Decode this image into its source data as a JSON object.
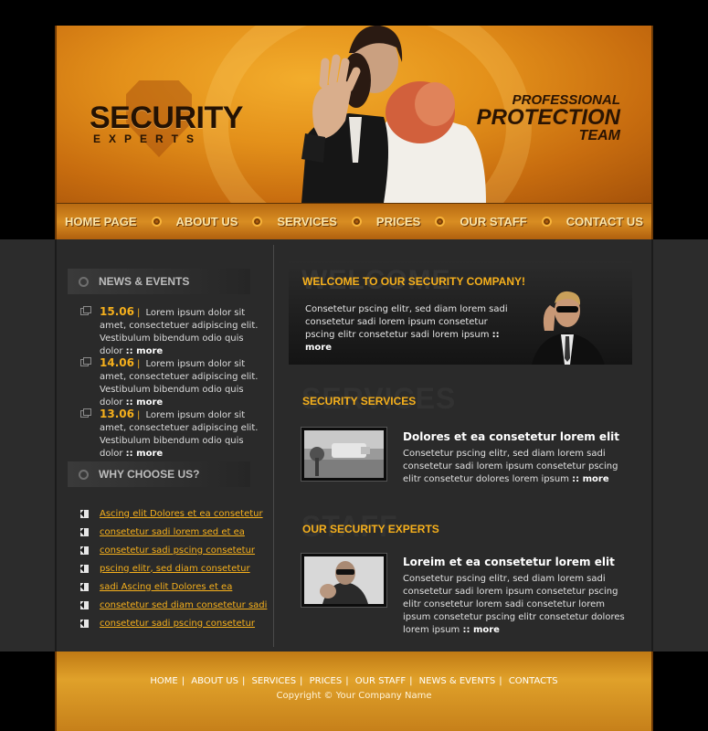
{
  "header": {
    "logo_title": "SECURITY",
    "logo_sub": "EXPERTS",
    "tagline_1": "PROFESSIONAL",
    "tagline_2": "PROTECTION",
    "tagline_3": "TEAM"
  },
  "nav": {
    "items": [
      "HOME PAGE",
      "ABOUT US",
      "SERVICES",
      "PRICES",
      "OUR STAFF",
      "CONTACT US"
    ]
  },
  "sidebar": {
    "news_title": "NEWS & EVENTS",
    "news": [
      {
        "date": "15.06",
        "text": "Lorem ipsum dolor sit amet, consectetuer adipiscing elit. Vestibulum bibendum odio quis dolor",
        "more": "more"
      },
      {
        "date": "14.06",
        "text": "Lorem ipsum dolor sit amet, consectetuer adipiscing elit. Vestibulum bibendum odio quis dolor",
        "more": "more"
      },
      {
        "date": "13.06",
        "text": "Lorem ipsum dolor sit amet, consectetuer adipiscing elit. Vestibulum bibendum odio quis dolor",
        "more": "more"
      }
    ],
    "why_title": "WHY CHOOSE US?",
    "links": [
      "Ascing elit Dolores et ea consetetur",
      "consetetur sadi lorem sed  et ea",
      "consetetur sadi pscing consetetur",
      "pscing elitr, sed diam consetetur",
      "sadi Ascing elit Dolores et ea",
      "consetetur sed diam consetetur sadi",
      "consetetur sadi pscing consetetur "
    ]
  },
  "welcome": {
    "ghost": "WELCOME",
    "title": "WELCOME TO OUR SECURITY COMPANY!",
    "text": "Consetetur pscing elitr, sed diam lorem sadi consetetur sadi lorem ipsum consetetur pscing elitr consetetur sadi lorem ipsum",
    "more": "more"
  },
  "services": {
    "ghost": "SERVICES",
    "title": "SECURITY SERVICES",
    "article_title": "Dolores et ea consetetur lorem elit",
    "article_text": "Consetetur pscing elitr, sed diam lorem sadi consetetur sadi lorem ipsum consetetur pscing elitr consetetur dolores lorem ipsum",
    "more": "more"
  },
  "experts": {
    "ghost": "STAFF",
    "title": "OUR SECURITY EXPERTS",
    "article_title": "Loreim et ea consetetur lorem elit",
    "article_text": "Consetetur pscing elitr, sed diam lorem sadi consetetur sadi lorem ipsum consetetur pscing elitr consetetur lorem sadi consetetur lorem ipsum consetetur pscing elitr consetetur dolores lorem ipsum",
    "more": "more"
  },
  "footer": {
    "links": [
      "HOME",
      "ABOUT US",
      "SERVICES",
      "PRICES",
      "OUR STAFF",
      "NEWS & EVENTS",
      "CONTACTS"
    ],
    "copyright": "Copyright © Your Company Name"
  },
  "colors": {
    "accent": "#f6b01c",
    "header_orange": "#e3901a",
    "dark_bg": "#2a2a2a"
  }
}
